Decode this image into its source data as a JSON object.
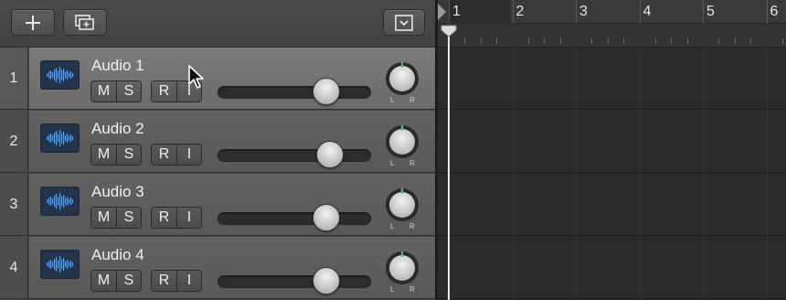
{
  "toolbar": {
    "add_icon": "plus-icon",
    "duplicate_icon": "duplicate-track-icon",
    "menu_icon": "track-menu-icon"
  },
  "tracks": [
    {
      "number": "1",
      "name": "Audio 1",
      "mute": "M",
      "solo": "S",
      "record": "R",
      "input": "I",
      "volume": 0.71,
      "selected": true
    },
    {
      "number": "2",
      "name": "Audio 2",
      "mute": "M",
      "solo": "S",
      "record": "R",
      "input": "I",
      "volume": 0.73,
      "selected": false
    },
    {
      "number": "3",
      "name": "Audio 3",
      "mute": "M",
      "solo": "S",
      "record": "R",
      "input": "I",
      "volume": 0.71,
      "selected": false
    },
    {
      "number": "4",
      "name": "Audio 4",
      "mute": "M",
      "solo": "S",
      "record": "R",
      "input": "I",
      "volume": 0.71,
      "selected": false
    }
  ],
  "pan": {
    "left_label": "L",
    "right_label": "R"
  },
  "ruler": {
    "bars": [
      "1",
      "2",
      "3",
      "4",
      "5",
      "6"
    ]
  },
  "colors": {
    "pan_indicator": "#55c26a",
    "track_icon_waveform": "#4aa3ff"
  }
}
